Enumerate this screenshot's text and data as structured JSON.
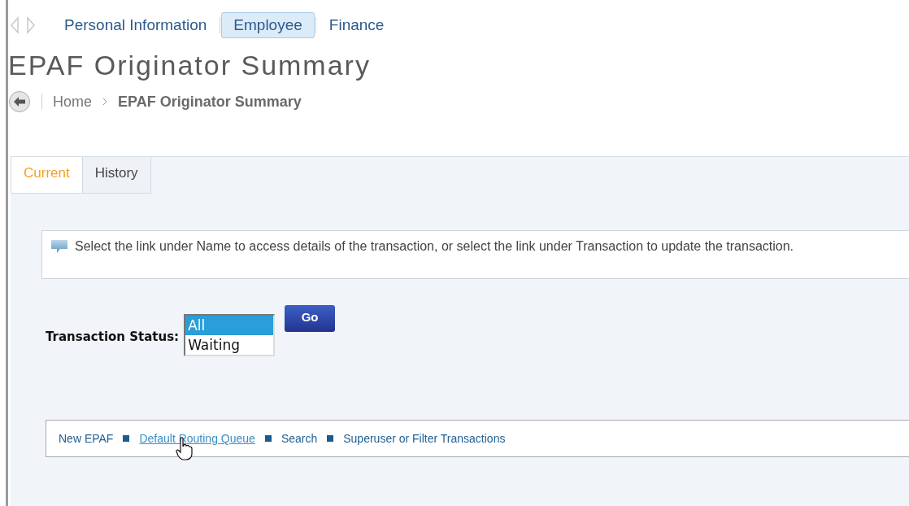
{
  "top_nav": [
    {
      "label": "Personal Information",
      "selected": false
    },
    {
      "label": "Employee",
      "selected": true
    },
    {
      "label": "Finance",
      "selected": false
    }
  ],
  "title": "EPAF Originator Summary",
  "breadcrumb": [
    "Home",
    "EPAF Originator Summary"
  ],
  "tabs": [
    {
      "label": "Current",
      "selected": true
    },
    {
      "label": "History",
      "selected": false
    }
  ],
  "info_message": "Select the link under Name to access details of the transaction, or select the link under Transaction to update the transaction.",
  "status_filter": {
    "label": "Transaction Status:",
    "options": [
      {
        "label": "All",
        "selected": true
      },
      {
        "label": "Waiting",
        "selected": false
      }
    ],
    "button": "Go"
  },
  "links": [
    {
      "label": "New EPAF",
      "hovered": false
    },
    {
      "label": "Default Routing Queue",
      "hovered": true
    },
    {
      "label": "Search",
      "hovered": false
    },
    {
      "label": "Superuser or Filter Transactions",
      "hovered": false
    }
  ]
}
